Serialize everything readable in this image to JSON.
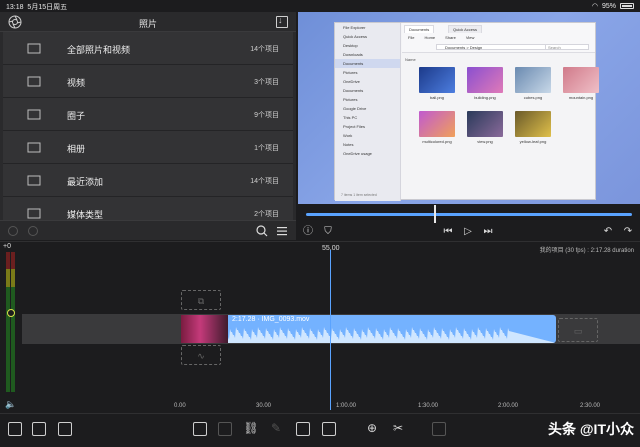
{
  "status_bar": {
    "time": "13:18",
    "date": "5月15日周五",
    "battery": "95%"
  },
  "photos_panel": {
    "title": "照片",
    "albums": [
      {
        "name": "全部照片和视频",
        "count": "14个项目",
        "icon": "folder-icon"
      },
      {
        "name": "视频",
        "count": "3个项目",
        "icon": "video-camera-icon"
      },
      {
        "name": "圈子",
        "count": "9个项目",
        "icon": "shared-album-icon"
      },
      {
        "name": "相册",
        "count": "1个项目",
        "icon": "photo-stack-icon"
      },
      {
        "name": "最近添加",
        "count": "14个项目",
        "icon": "folder-icon"
      },
      {
        "name": "媒体类型",
        "count": "2个项目",
        "icon": "folder-icon"
      }
    ]
  },
  "preview": {
    "explorer": {
      "tabs": [
        "Documents",
        "Quick Access"
      ],
      "menu": [
        "File",
        "Home",
        "Share",
        "View"
      ],
      "path": "Documents > Design",
      "search_placeholder": "Search",
      "sort_label": "Name",
      "sidebar": [
        "File Explorer",
        "Quick Access",
        "Desktop",
        "Downloads",
        "Documents",
        "Pictures",
        "OneDrive",
        "Documents",
        "Pictures",
        "Google Drive",
        "This PC",
        "Project Files",
        "Work",
        "Notes",
        "OneDrive usage"
      ],
      "files": [
        {
          "name": "ball.png",
          "color1": "#1c3a8a",
          "color2": "#4d7ee0"
        },
        {
          "name": "building.png",
          "color1": "#8a4fd0",
          "color2": "#e07ab8"
        },
        {
          "name": "cubes.png",
          "color1": "#6a8ab0",
          "color2": "#c8d8e8"
        },
        {
          "name": "mountain.png",
          "color1": "#d07a8a",
          "color2": "#f0c0c8"
        },
        {
          "name": "multicolored.png",
          "color1": "#c05ad0",
          "color2": "#f0a05a"
        },
        {
          "name": "view.png",
          "color1": "#2a3a5a",
          "color2": "#8a6a9a"
        },
        {
          "name": "yellow-leaf.png",
          "color1": "#6a5a2a",
          "color2": "#e0c04a"
        }
      ],
      "status": "7 items  1 item selected"
    }
  },
  "timeline": {
    "gain_label": "+0",
    "ruler_mark": "55.00",
    "project_info": "我的项目 (30 fps) : 2:17.28 duration",
    "clip_label": "2:17.28 · IMG_0093.mov",
    "timecodes": [
      "0.00",
      "30.00",
      "1:00.00",
      "1:30.00",
      "2:00.00",
      "2:30.00"
    ]
  },
  "watermark": "头条 @IT小众"
}
